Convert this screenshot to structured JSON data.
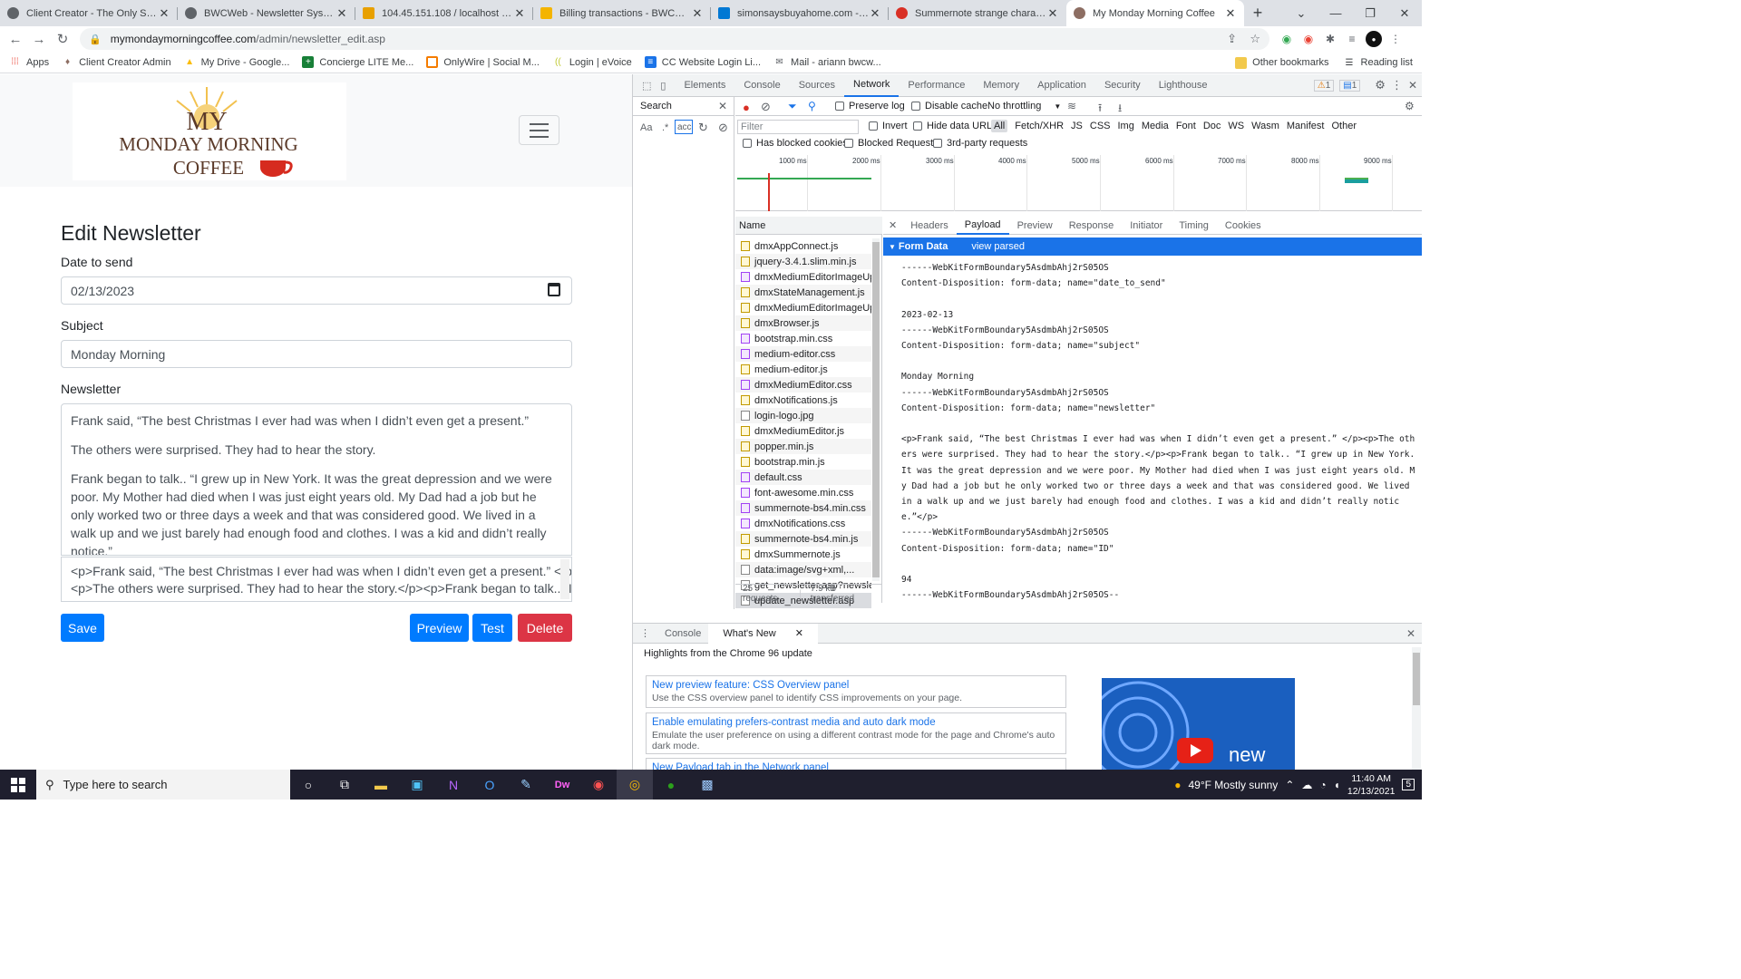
{
  "tabs": [
    {
      "title": "Client Creator - The Only Systen",
      "active": false
    },
    {
      "title": "BWCWeb - Newsletter System",
      "active": false
    },
    {
      "title": "104.45.151.108 / localhost / myn",
      "active": false
    },
    {
      "title": "Billing transactions - BWCWeb -",
      "active": false
    },
    {
      "title": "simonsaysbuyahome.com - Mic",
      "active": false
    },
    {
      "title": "Summernote strange characters",
      "active": false
    },
    {
      "title": "My Monday Morning Coffee",
      "active": true
    }
  ],
  "address": {
    "domain": "mymondaymorningcoffee.com",
    "path": "/admin/newsletter_edit.asp"
  },
  "bookmarks": {
    "items": [
      "Apps",
      "Client Creator Admin",
      "My Drive - Google...",
      "Concierge LITE Me...",
      "OnlyWire | Social M...",
      "Login | eVoice",
      "CC Website Login Li...",
      "Mail - ariann bwcw..."
    ],
    "other": "Other bookmarks",
    "reading": "Reading list"
  },
  "site": {
    "logo_my": "MY",
    "logo_line2": "MONDAY MORNING",
    "logo_line3": "COFFEE"
  },
  "form": {
    "title": "Edit Newsletter",
    "date_label": "Date to send",
    "date_value": "02/13/2023",
    "subject_label": "Subject",
    "subject_value": "Monday Morning",
    "newsletter_label": "Newsletter",
    "para1": "Frank said, “The best Christmas I ever had was when I didn’t even get a present.”",
    "para2": "The others were surprised. They had to hear the story.",
    "para3": "Frank began to talk.. “I grew up in New York. It was the great depression and we were poor. My Mother had died when I was just eight years old. My Dad had a job but he only worked two or three days a week and that was considered good. We lived in a walk up and we just barely had enough food and clothes. I was a kid and didn’t really notice.”",
    "code_line1": "<p>Frank said, “The best Christmas I ever had was when I didn’t even get a present.” </p>",
    "code_line2": "<p>The others were surprised. They had to hear the story.</p><p>Frank began to talk.. “I",
    "save": "Save",
    "preview": "Preview",
    "test": "Test",
    "delete": "Delete"
  },
  "devtools": {
    "tabs": [
      "Elements",
      "Console",
      "Sources",
      "Network",
      "Performance",
      "Memory",
      "Application",
      "Security",
      "Lighthouse"
    ],
    "active_tab": "Network",
    "warn_count": "1",
    "msg_count": "1",
    "search_label": "Search",
    "search_case": "Aa",
    "search_regex": ".*",
    "search_value": "acc",
    "preserve_log": "Preserve log",
    "disable_cache": "Disable cache",
    "throttling": "No throttling",
    "filter_placeholder": "Filter",
    "invert": "Invert",
    "hide_data_urls": "Hide data URLs",
    "filters": [
      "All",
      "Fetch/XHR",
      "JS",
      "CSS",
      "Img",
      "Media",
      "Font",
      "Doc",
      "WS",
      "Wasm",
      "Manifest",
      "Other"
    ],
    "blocked_cookies": "Has blocked cookies",
    "blocked_requests": "Blocked Requests",
    "third_party": "3rd-party requests",
    "timeline_ticks": [
      "1000 ms",
      "2000 ms",
      "3000 ms",
      "4000 ms",
      "5000 ms",
      "6000 ms",
      "7000 ms",
      "8000 ms",
      "9000 ms"
    ],
    "name_header": "Name",
    "requests": [
      {
        "name": "dmxAppConnect.js",
        "kind": "js"
      },
      {
        "name": "jquery-3.4.1.slim.min.js",
        "kind": "js"
      },
      {
        "name": "dmxMediumEditorImageUplc",
        "kind": "css"
      },
      {
        "name": "dmxStateManagement.js",
        "kind": "js"
      },
      {
        "name": "dmxMediumEditorImageUplc",
        "kind": "js"
      },
      {
        "name": "dmxBrowser.js",
        "kind": "js"
      },
      {
        "name": "bootstrap.min.css",
        "kind": "css"
      },
      {
        "name": "medium-editor.css",
        "kind": "css"
      },
      {
        "name": "medium-editor.js",
        "kind": "js"
      },
      {
        "name": "dmxMediumEditor.css",
        "kind": "css"
      },
      {
        "name": "dmxNotifications.js",
        "kind": "js"
      },
      {
        "name": "login-logo.jpg",
        "kind": "gen"
      },
      {
        "name": "dmxMediumEditor.js",
        "kind": "js"
      },
      {
        "name": "popper.min.js",
        "kind": "js"
      },
      {
        "name": "bootstrap.min.js",
        "kind": "js"
      },
      {
        "name": "default.css",
        "kind": "css"
      },
      {
        "name": "font-awesome.min.css",
        "kind": "css"
      },
      {
        "name": "summernote-bs4.min.css",
        "kind": "css"
      },
      {
        "name": "dmxNotifications.css",
        "kind": "css"
      },
      {
        "name": "summernote-bs4.min.js",
        "kind": "js"
      },
      {
        "name": "dmxSummernote.js",
        "kind": "js"
      },
      {
        "name": "data:image/svg+xml,...",
        "kind": "gen"
      },
      {
        "name": "get_newsletter.asp?newslette",
        "kind": "gen"
      },
      {
        "name": "update_newsletter.asp",
        "kind": "gen"
      }
    ],
    "requests_count": "25 requests",
    "transferred": "7.9 kB transferred",
    "detail_tabs": [
      "Headers",
      "Payload",
      "Preview",
      "Response",
      "Initiator",
      "Timing",
      "Cookies"
    ],
    "detail_active": "Payload",
    "form_data": "Form Data",
    "view_parsed": "view parsed",
    "payload": "------WebKitFormBoundary5AsdmbAhj2rS05OS\nContent-Disposition: form-data; name=\"date_to_send\"\n\n2023-02-13\n------WebKitFormBoundary5AsdmbAhj2rS05OS\nContent-Disposition: form-data; name=\"subject\"\n\nMonday Morning\n------WebKitFormBoundary5AsdmbAhj2rS05OS\nContent-Disposition: form-data; name=\"newsletter\"\n\n<p>Frank said, “The best Christmas I ever had was when I didn’t even get a present.” </p><p>The others were surprised. They had to hear the story.</p><p>Frank began to talk.. “I grew up in New York. It was the great depression and we were poor. My Mother had died when I was just eight years old. My Dad had a job but he only worked two or three days a week and that was considered good. We lived in a walk up and we just barely had enough food and clothes. I was a kid and didn’t really notice.”</p>\n------WebKitFormBoundary5AsdmbAhj2rS05OS\nContent-Disposition: form-data; name=\"ID\"\n\n94\n------WebKitFormBoundary5AsdmbAhj2rS05OS--",
    "drawer_tabs": [
      "Console",
      "What's New"
    ],
    "whats_new_title": "Highlights from the Chrome 96 update",
    "cards": [
      {
        "title": "New preview feature: CSS Overview panel",
        "desc": "Use the CSS overview panel to identify CSS improvements on your page."
      },
      {
        "title": "Enable emulating prefers-contrast media and auto dark mode",
        "desc": "Emulate the user preference on using a different contrast mode for the page and Chrome's auto dark mode."
      },
      {
        "title": "New Payload tab in the Network panel",
        "desc": ""
      }
    ],
    "video_label": "new"
  },
  "taskbar": {
    "search_placeholder": "Type here to search",
    "weather": "49°F  Mostly sunny",
    "time": "11:40 AM",
    "date": "12/13/2021",
    "notif": "5"
  }
}
